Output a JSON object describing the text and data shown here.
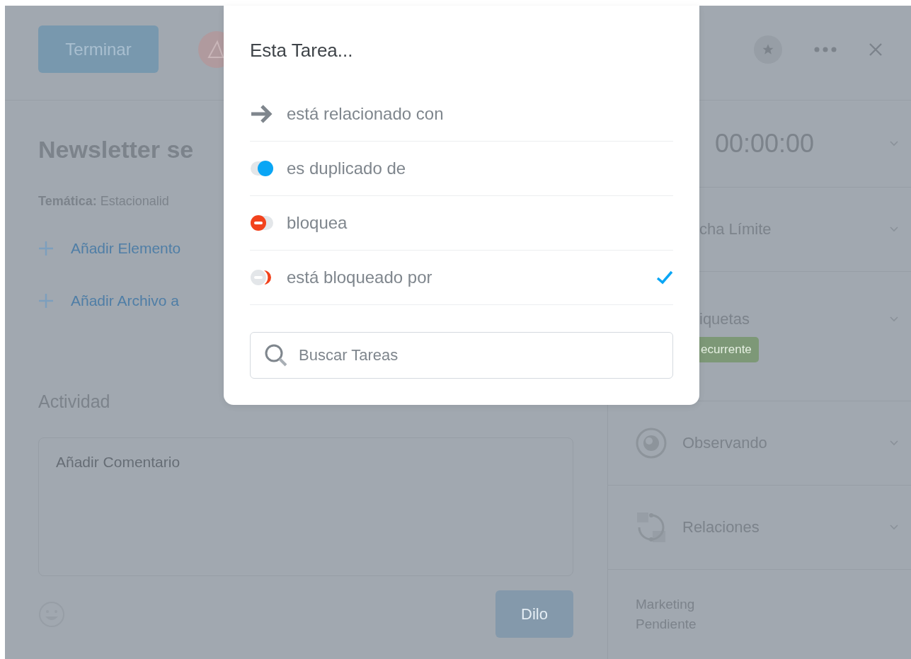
{
  "task_panel": {
    "finish_button": "Terminar",
    "title": "Newsletter se",
    "topic": "**Temática:** Estacionalid",
    "add_links": [
      "Añadir Elemento",
      "Añadir Archivo a"
    ],
    "activity_heading": "Actividad",
    "comment_field": {
      "placeholder": "Añadir Comentario"
    },
    "submit_button": "Dilo"
  },
  "sidebar": {
    "timer": "00:00:00",
    "sections": [
      {
        "label": "cha Límite",
        "kind": "clipped"
      },
      {
        "label": "iquetas",
        "kind": "clipped",
        "tags": [
          "ecurrente"
        ]
      },
      {
        "label": "Observando",
        "kind": "eye"
      },
      {
        "label": "Relaciones",
        "kind": "relations"
      }
    ],
    "footer": [
      "Marketing",
      "Pendiente"
    ]
  },
  "dialog": {
    "title": "Esta Tarea...",
    "options": [
      {
        "label": "está relacionado con",
        "kind": "related",
        "selected": false
      },
      {
        "label": "es duplicado de",
        "kind": "duplicate",
        "selected": false
      },
      {
        "label": "bloquea",
        "kind": "blocks",
        "selected": false
      },
      {
        "label": "está bloqueado por",
        "kind": "blocked-by",
        "selected": true
      }
    ],
    "search": {
      "placeholder": "Buscar Tareas"
    }
  }
}
